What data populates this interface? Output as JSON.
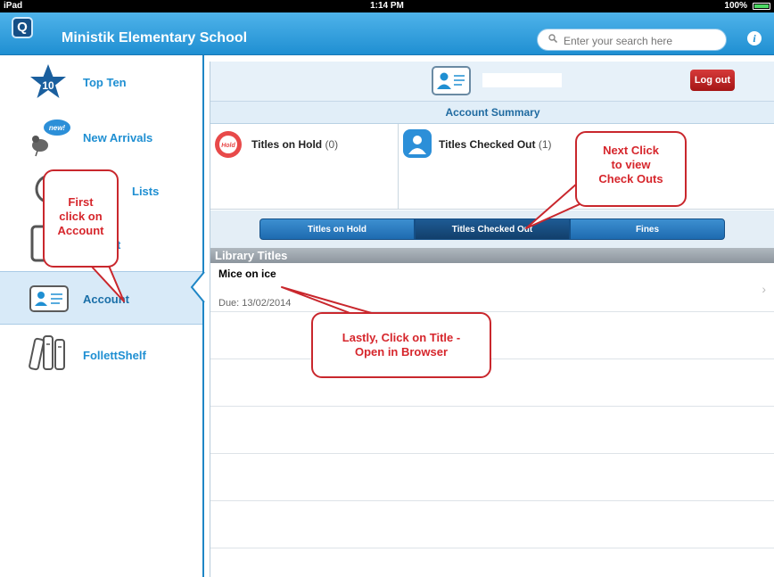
{
  "status_bar": {
    "device": "iPad",
    "time": "1:14 PM",
    "battery": "100%"
  },
  "header": {
    "logo": "Q",
    "title": "Ministik Elementary School",
    "search_placeholder": "Enter your search here",
    "info_icon": "i"
  },
  "sidebar": {
    "items": [
      {
        "label": "Top Ten",
        "icon": "star-10-icon",
        "badge": "10"
      },
      {
        "label": "New Arrivals",
        "icon": "bird-new-icon",
        "badge": "new!"
      },
      {
        "label": "Lists",
        "icon": "lists-icon"
      },
      {
        "label": "t",
        "icon": "book-icon"
      },
      {
        "label": "Account",
        "icon": "account-card-icon",
        "active": true
      },
      {
        "label": "FollettShelf",
        "icon": "follettshelf-icon"
      }
    ]
  },
  "account": {
    "logout": "Log out",
    "summary_title": "Account Summary",
    "holds": {
      "label": "Titles on Hold",
      "count": "(0)",
      "badge": "Hold"
    },
    "checked_out": {
      "label": "Titles Checked Out",
      "count": "(1)"
    }
  },
  "tabs": [
    "Titles on Hold",
    "Titles Checked Out",
    "Fines"
  ],
  "library": {
    "heading": "Library Titles",
    "items": [
      {
        "title": "Mice on ice",
        "due": "Due: 13/02/2014"
      }
    ]
  },
  "callouts": {
    "first": [
      "First",
      "click on",
      "Account"
    ],
    "next": [
      "Next Click",
      "to view",
      "Check Outs"
    ],
    "last": [
      "Lastly, Click on Title -",
      "Open in Browser"
    ]
  },
  "colors": {
    "brand": "#1f8fd2",
    "callout_red": "#d6262c",
    "logout_red": "#b51f1f"
  }
}
